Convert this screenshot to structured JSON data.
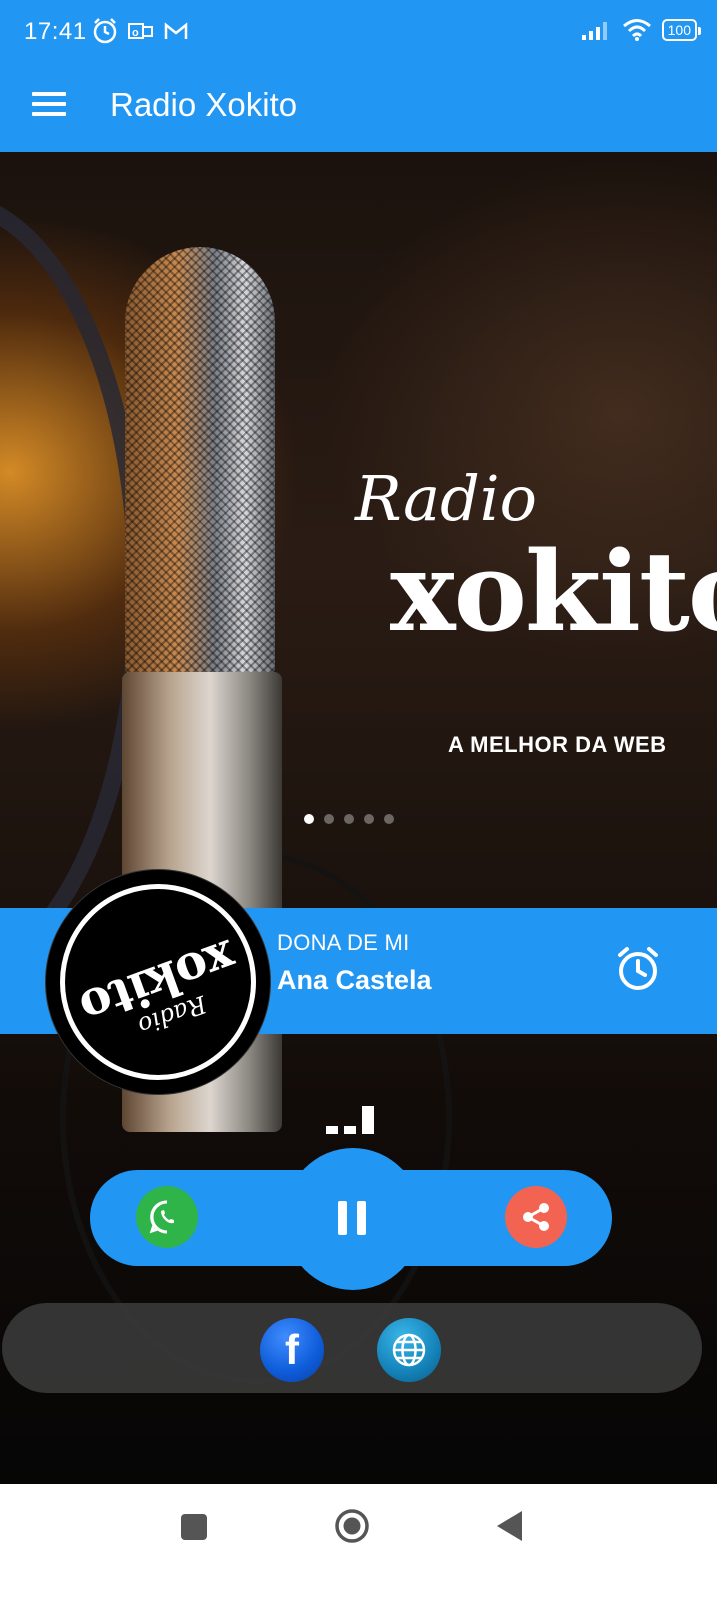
{
  "status_bar": {
    "time": "17:41",
    "battery": "100",
    "left_icons": [
      "alarm-icon",
      "outlook-icon",
      "gmail-icon"
    ],
    "right_icons": [
      "signal-icon",
      "wifi-icon",
      "battery-icon"
    ]
  },
  "app_bar": {
    "title": "Radio Xokito",
    "menu_icon": "hamburger-menu-icon",
    "color": "#2196F3"
  },
  "banner": {
    "script_text": "Radio",
    "brand_text": "xokito",
    "tagline": "A MELHOR DA WEB",
    "carousel": {
      "total": 5,
      "active": 1
    }
  },
  "now_playing": {
    "logo_title": "xokito",
    "logo_subtitle": "Radio",
    "song_title": "DONA DE MI",
    "artist": "Ana Castela",
    "alarm_icon": "alarm-clock-icon"
  },
  "controls": {
    "whatsapp_icon": "whatsapp-icon",
    "play_state_icon": "pause-icon",
    "share_icon": "share-icon",
    "whatsapp_color": "#2fb44a",
    "share_color": "#f26451"
  },
  "social": {
    "facebook_label": "f",
    "facebook_icon": "facebook-icon",
    "website_icon": "globe-icon"
  },
  "nav_bar": {
    "icons": [
      "recents-icon",
      "home-icon",
      "back-icon"
    ]
  }
}
